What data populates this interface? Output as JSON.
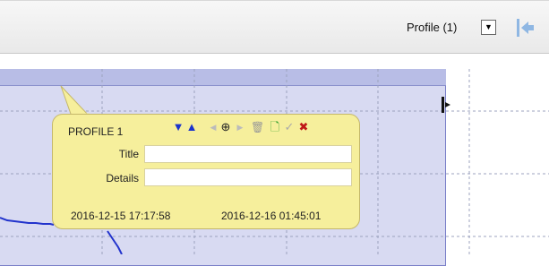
{
  "toolbar": {
    "profile_label": "Profile (1)",
    "dropdown_arrow": "▼",
    "collapse_icon": "collapse-left-icon"
  },
  "popup": {
    "title": "PROFILE 1",
    "tools": [
      {
        "name": "move-down-icon",
        "glyph": "▼",
        "color": "#1a33cc"
      },
      {
        "name": "move-up-icon",
        "glyph": "▲",
        "color": "#1a33cc"
      },
      {
        "name": "previous-icon",
        "glyph": "◀",
        "color": "#bbbbbb"
      },
      {
        "name": "zoom-icon",
        "glyph": "⊕",
        "color": "#222222"
      },
      {
        "name": "next-icon",
        "glyph": "▶",
        "color": "#bbbbbb"
      },
      {
        "name": "delete-icon",
        "glyph": "🗑",
        "color": "#999999"
      },
      {
        "name": "new-icon",
        "glyph": "🗋",
        "color": "#2e9e2e"
      },
      {
        "name": "confirm-icon",
        "glyph": "✓",
        "color": "#aaaaaa"
      },
      {
        "name": "close-icon",
        "glyph": "✖",
        "color": "#c01818"
      }
    ],
    "title_label": "Title",
    "title_value": "",
    "details_label": "Details",
    "details_value": "",
    "start_time": "2016-12-15 17:17:58",
    "end_time": "2016-12-16 01:45:01"
  },
  "colors": {
    "popup_bg": "#f6ef9c",
    "plot_fill": "#d8daf2",
    "plot_border": "#7a7fc8",
    "series": "#2233cc"
  }
}
